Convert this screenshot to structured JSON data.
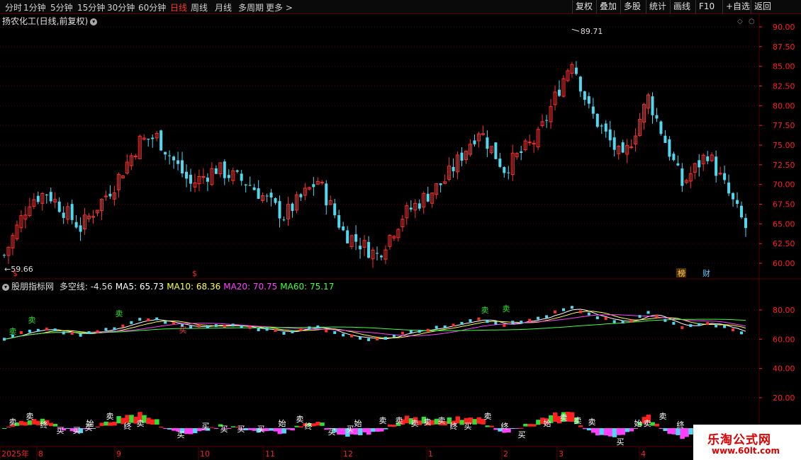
{
  "toolbar": {
    "periods": [
      "分时",
      "1分钟",
      "5分钟",
      "15分钟",
      "30分钟",
      "60分钟",
      "日线",
      "周线",
      "月线",
      "多周期",
      "更多 >"
    ],
    "active": "日线",
    "right": [
      "复权",
      "叠加",
      "多股",
      "统计",
      "画线",
      "F10",
      "+自选",
      "返回"
    ]
  },
  "kline": {
    "title": "扬农化工(日线,前复权)",
    "high_label": "89.71",
    "low_label": "59.66",
    "high_value": 89.71,
    "low_value": 59.66,
    "yticks": [
      "90.00",
      "87.50",
      "85.00",
      "82.50",
      "80.00",
      "77.50",
      "75.00",
      "72.50",
      "70.00",
      "67.50",
      "65.00",
      "62.50",
      "60.00"
    ],
    "markers": [
      "$",
      "$",
      "榜",
      "财"
    ]
  },
  "indicator": {
    "name": "股朋指标网",
    "items": [
      {
        "label": "多空线:",
        "value": "-4.56",
        "color": "#dddddd"
      },
      {
        "label": "MA5:",
        "value": "65.73",
        "color": "#ffffff"
      },
      {
        "label": "MA10:",
        "value": "68.36",
        "color": "#ffff40"
      },
      {
        "label": "MA20:",
        "value": "70.75",
        "color": "#ff40ff"
      },
      {
        "label": "MA60:",
        "value": "75.17",
        "color": "#40ff40"
      }
    ],
    "yticks": [
      "80.00",
      "60.00",
      "40.00",
      "20.00"
    ]
  },
  "signals": {
    "buy": "买",
    "sell": "卖",
    "start": "始",
    "end": "终"
  },
  "xaxis": {
    "labels": [
      "2025年",
      "8",
      "9",
      "10",
      "11",
      "12",
      "1",
      "2",
      "3",
      "4"
    ]
  },
  "colors": {
    "up": "#ff3030",
    "down": "#4fd8f0",
    "grid": "#5a0000",
    "axis": "#ff2020"
  },
  "watermark": {
    "line1": "乐淘公式网",
    "line2": "www.60lt.com"
  }
}
